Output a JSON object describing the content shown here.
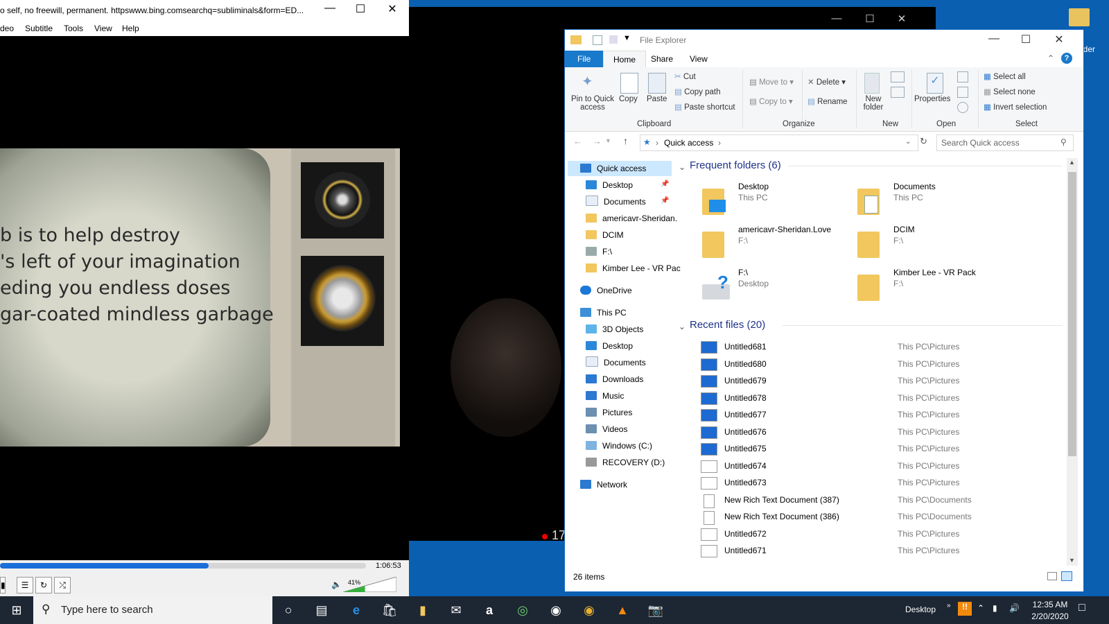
{
  "vlc": {
    "title": "o self, no freewill, permanent. httpswww.bing.comsearchq=subliminals&form=ED...",
    "menu": [
      "deo",
      "Subtitle",
      "Tools",
      "View",
      "Help"
    ],
    "subtitle_lines": [
      "b is to help destroy",
      "'s left of your imagination",
      "eding you endless doses",
      "gar-coated mindless garbage"
    ],
    "time": "1:06:53",
    "progress": 0.57,
    "volume": "41%"
  },
  "background": {
    "number": "17"
  },
  "desktop": {
    "folder_label": "lder"
  },
  "explorer": {
    "title": "File Explorer",
    "tabs": {
      "file": "File",
      "home": "Home",
      "share": "Share",
      "view": "View"
    },
    "ribbon": {
      "pin": "Pin to Quick access",
      "pin_a": "Pin to Quick",
      "pin_b": "access",
      "copy": "Copy",
      "paste": "Paste",
      "cut": "Cut",
      "copy_path": "Copy path",
      "paste_shortcut": "Paste shortcut",
      "clipboard": "Clipboard",
      "move_to": "Move to",
      "copy_to": "Copy to",
      "delete": "Delete",
      "rename": "Rename",
      "organize": "Organize",
      "new_folder_a": "New",
      "new_folder_b": "folder",
      "new": "New",
      "properties": "Properties",
      "open": "Open",
      "select_all": "Select all",
      "select_none": "Select none",
      "invert_selection": "Invert selection",
      "select": "Select"
    },
    "address": "Quick access",
    "search_placeholder": "Search Quick access",
    "nav": [
      {
        "label": "Quick access",
        "color": "#2b79d0"
      },
      {
        "label": "Desktop",
        "color": "#2b88d8"
      },
      {
        "label": "Documents",
        "color": "#e7eef8"
      },
      {
        "label": "americavr-Sheridan.",
        "color": "#f1c75e"
      },
      {
        "label": "DCIM",
        "color": "#f1c75e"
      },
      {
        "label": "F:\\",
        "color": "#9aa"
      },
      {
        "label": "Kimber Lee - VR Pac",
        "color": "#f1c75e"
      },
      {
        "label": "OneDrive",
        "color": "#1b78d8"
      },
      {
        "label": "This PC",
        "color": "#3c8fd8"
      },
      {
        "label": "3D Objects",
        "color": "#5db4e8"
      },
      {
        "label": "Desktop",
        "color": "#2b88d8"
      },
      {
        "label": "Documents",
        "color": "#e7eef8"
      },
      {
        "label": "Downloads",
        "color": "#2b79d0"
      },
      {
        "label": "Music",
        "color": "#2b79d0"
      },
      {
        "label": "Pictures",
        "color": "#6d8fb0"
      },
      {
        "label": "Videos",
        "color": "#6d8fb0"
      },
      {
        "label": "Windows (C:)",
        "color": "#7fb3e0"
      },
      {
        "label": "RECOVERY (D:)",
        "color": "#999"
      },
      {
        "label": "Network",
        "color": "#2b79d0"
      }
    ],
    "frequent_header": "Frequent folders (6)",
    "frequent": [
      {
        "name": "Desktop",
        "loc": "This PC"
      },
      {
        "name": "Documents",
        "loc": "This PC"
      },
      {
        "name": "americavr-Sheridan.Love",
        "loc": "F:\\"
      },
      {
        "name": "DCIM",
        "loc": "F:\\"
      },
      {
        "name": "F:\\",
        "loc": "Desktop"
      },
      {
        "name": "Kimber Lee - VR Pack",
        "loc": "F:\\"
      }
    ],
    "recent_header": "Recent files (20)",
    "recent": [
      {
        "name": "Untitled681",
        "path": "This PC\\Pictures"
      },
      {
        "name": "Untitled680",
        "path": "This PC\\Pictures"
      },
      {
        "name": "Untitled679",
        "path": "This PC\\Pictures"
      },
      {
        "name": "Untitled678",
        "path": "This PC\\Pictures"
      },
      {
        "name": "Untitled677",
        "path": "This PC\\Pictures"
      },
      {
        "name": "Untitled676",
        "path": "This PC\\Pictures"
      },
      {
        "name": "Untitled675",
        "path": "This PC\\Pictures"
      },
      {
        "name": "Untitled674",
        "path": "This PC\\Pictures"
      },
      {
        "name": "Untitled673",
        "path": "This PC\\Pictures"
      },
      {
        "name": "New Rich Text Document (387)",
        "path": "This PC\\Documents"
      },
      {
        "name": "New Rich Text Document (386)",
        "path": "This PC\\Documents"
      },
      {
        "name": "Untitled672",
        "path": "This PC\\Pictures"
      },
      {
        "name": "Untitled671",
        "path": "This PC\\Pictures"
      }
    ],
    "status": "26 items"
  },
  "taskbar": {
    "search_placeholder": "Type here to search",
    "desktop_label": "Desktop",
    "time": "12:35 AM",
    "date": "2/20/2020"
  },
  "colors": {
    "accent": "#1979ca",
    "taskbar": "#1d2633",
    "section": "#1e3287"
  }
}
